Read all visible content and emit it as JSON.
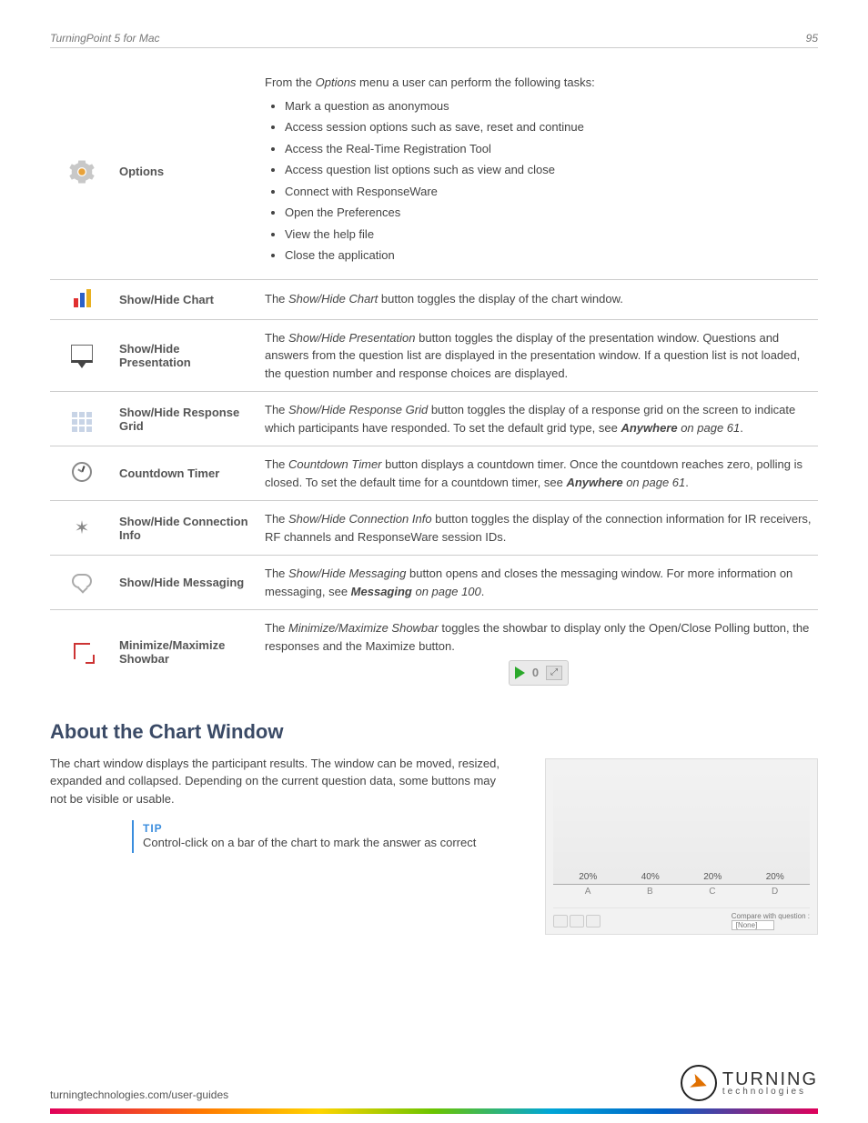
{
  "header": {
    "doc_title": "TurningPoint 5 for Mac",
    "page_number": "95"
  },
  "rows": {
    "options": {
      "label": "Options",
      "intro_pre": "From the ",
      "intro_em": "Options",
      "intro_post": " menu a user can perform the following tasks:",
      "items": [
        "Mark a question as anonymous",
        "Access session options such as save, reset and continue",
        "Access the Real-Time Registration Tool",
        "Access question list options such as view and close",
        "Connect with ResponseWare",
        "Open the Preferences",
        "View the help file",
        "Close the application"
      ]
    },
    "chart": {
      "label": "Show/Hide Chart",
      "pre": "The ",
      "em": "Show/Hide Chart",
      "post": " button toggles the display of the chart window."
    },
    "presentation": {
      "label": "Show/Hide Presentation",
      "pre": "The ",
      "em": "Show/Hide Presentation",
      "post": " button toggles the display of the presentation window. Questions and answers from the question list are displayed in the presentation window. If a question list is not loaded, the question number and response choices are displayed."
    },
    "grid": {
      "label": "Show/Hide Response Grid",
      "pre": "The ",
      "em": "Show/Hide Response Grid",
      "post1": " button toggles the display of a response grid on the screen to indicate which participants have responded. To set the default grid type, see ",
      "link": "Anywhere",
      "post2": " on page 61",
      "post3": "."
    },
    "timer": {
      "label": "Countdown Timer",
      "pre": "The ",
      "em": "Countdown Timer",
      "post1": " button displays a countdown timer. Once the countdown reaches zero, polling is closed. To set the default time for a countdown timer, see ",
      "link": "Anywhere",
      "post2": " on page 61",
      "post3": "."
    },
    "conn": {
      "label": "Show/Hide Connection Info",
      "pre": "The ",
      "em": "Show/Hide Connection Info",
      "post": " button toggles the display of the connection information for IR receivers, RF channels and ResponseWare session IDs."
    },
    "msg": {
      "label": "Show/Hide Messaging",
      "pre": "The ",
      "em": "Show/Hide Messaging",
      "post1": " button opens and closes the messaging window. For more information on messaging, see ",
      "link": "Messaging",
      "post2": " on page 100",
      "post3": "."
    },
    "showbar": {
      "label": "Minimize/Maximize Showbar",
      "pre": "The ",
      "em": "Minimize/Maximize Showbar",
      "post": " toggles the showbar to display only the Open/Close Polling button, the responses and the Maximize button.",
      "count": "0"
    }
  },
  "section": {
    "heading": "About the Chart Window",
    "para": "The chart window displays the participant results. The window can be moved, resized, expanded and collapsed. Depending on the current question data, some buttons may not be visible or usable.",
    "tip_label": "TIP",
    "tip_body": "Control-click on a bar of the chart to mark the answer as correct"
  },
  "chart_data": {
    "type": "bar",
    "categories": [
      "A",
      "B",
      "C",
      "D"
    ],
    "values": [
      20,
      40,
      20,
      20
    ],
    "value_labels": [
      "20%",
      "40%",
      "20%",
      "20%"
    ],
    "ylim": [
      0,
      50
    ],
    "compare_label": "Compare with question :",
    "compare_value": "[None]"
  },
  "footer": {
    "url": "turningtechnologies.com/user-guides",
    "logo_big": "TURNING",
    "logo_small": "technologies"
  }
}
